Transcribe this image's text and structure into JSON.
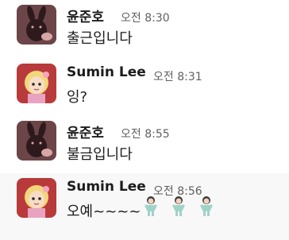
{
  "messages": [
    {
      "author": "윤준호",
      "time": "오전 8:30",
      "text": "출근입니다",
      "avatar_icon": "bunny-avatar-icon"
    },
    {
      "author": "Sumin Lee",
      "time": "오전 8:31",
      "text": "잉?",
      "avatar_icon": "girl-avatar-icon"
    },
    {
      "author": "윤준호",
      "time": "오전 8:55",
      "text": "불금입니다",
      "avatar_icon": "bunny-avatar-icon"
    },
    {
      "author": "Sumin Lee",
      "time": "오전 8:56",
      "text": "오예~~~~",
      "avatar_icon": "girl-avatar-icon",
      "emojis": [
        "dancing-person-emoji",
        "dancing-person-emoji",
        "dancing-person-emoji"
      ]
    }
  ],
  "colors": {
    "highlight_row": "#f8f8f8",
    "bunny_bg": "#6b4548",
    "girl_bg": "#b93a3a",
    "timestamp": "#616061"
  }
}
